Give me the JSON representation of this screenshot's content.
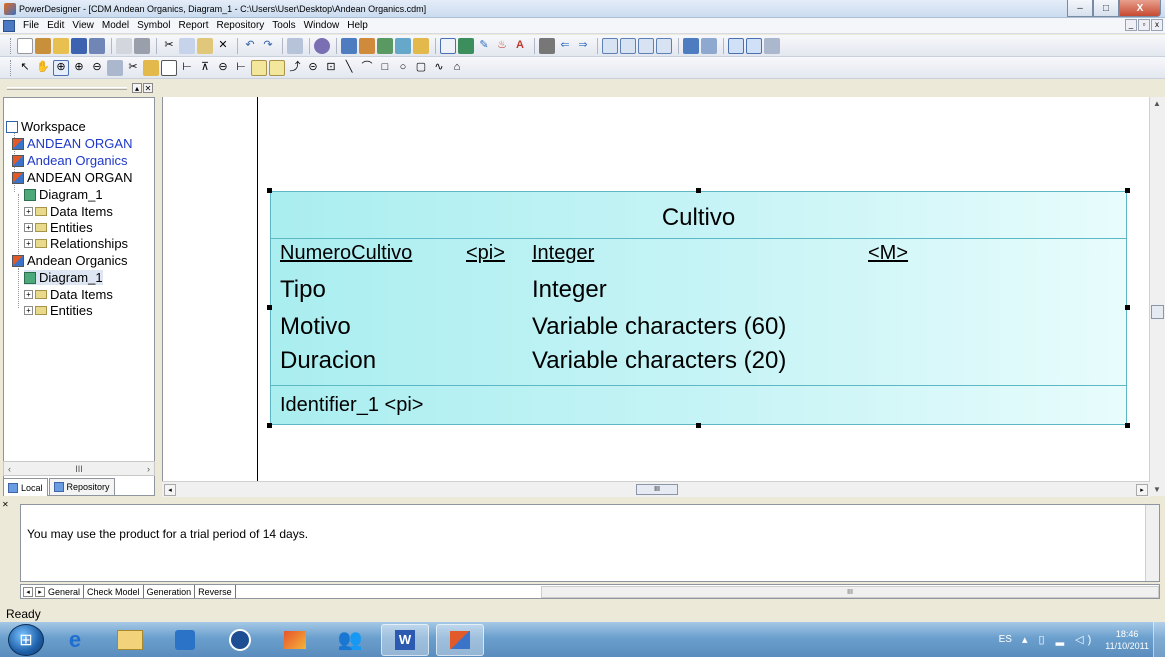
{
  "window": {
    "title": "PowerDesigner - [CDM Andean Organics, Diagram_1 - C:\\Users\\User\\Desktop\\Andean Organics.cdm]",
    "controls": {
      "minimize": "–",
      "maximize": "□",
      "close": "X"
    },
    "mdi_controls": {
      "minimize": "_",
      "restore": "▫",
      "close": "x"
    }
  },
  "menubar": {
    "items": [
      "File",
      "Edit",
      "View",
      "Model",
      "Symbol",
      "Report",
      "Repository",
      "Tools",
      "Window",
      "Help"
    ]
  },
  "browser": {
    "tree": [
      {
        "label": "Workspace",
        "kind": "workspace",
        "color": "black"
      },
      {
        "label": "ANDEAN ORGAN",
        "kind": "model",
        "color": "blue"
      },
      {
        "label": "Andean Organics",
        "kind": "model",
        "color": "blue"
      },
      {
        "label": "ANDEAN ORGAN",
        "kind": "model",
        "color": "black"
      },
      {
        "label": "Diagram_1",
        "kind": "diagram",
        "color": "black"
      },
      {
        "label": "Data Items",
        "kind": "folder",
        "color": "black"
      },
      {
        "label": "Entities",
        "kind": "folder",
        "color": "black"
      },
      {
        "label": "Relationships",
        "kind": "folder",
        "color": "black"
      },
      {
        "label": "Andean Organics",
        "kind": "model",
        "color": "black"
      },
      {
        "label": "Diagram_1",
        "kind": "diagram",
        "color": "black"
      },
      {
        "label": "Data Items",
        "kind": "folder",
        "color": "black"
      },
      {
        "label": "Entities",
        "kind": "folder",
        "color": "black"
      }
    ],
    "tabs": [
      "Local",
      "Repository"
    ],
    "scroll_thumb": "III"
  },
  "entity": {
    "name": "Cultivo",
    "attributes": [
      {
        "name": "NumeroCultivo",
        "pi": "<pi>",
        "type": "Integer",
        "mandatory": "<M>",
        "identifier": true
      },
      {
        "name": "Tipo",
        "pi": "",
        "type": "Integer",
        "mandatory": "",
        "identifier": false
      },
      {
        "name": "Motivo",
        "pi": "",
        "type": "Variable characters (60)",
        "mandatory": "",
        "identifier": false
      },
      {
        "name": "Duracion",
        "pi": "",
        "type": "Variable characters (20)",
        "mandatory": "",
        "identifier": false
      }
    ],
    "identifier": "Identifier_1  <pi>",
    "fill_color_start": "#aaeef0",
    "fill_color_end": "#e8fcfc",
    "border_color": "#5cb8c4"
  },
  "canvas_scroll_thumb": "III",
  "output": {
    "message": "You may use the product for a trial period of 14 days.",
    "tabs": [
      "General",
      "Check Model",
      "Generation",
      "Reverse"
    ],
    "scroll_thumb": "III"
  },
  "status": {
    "text": "Ready"
  },
  "taskbar": {
    "apps": [
      "internet-explorer-icon",
      "file-explorer-icon",
      "media-player-icon",
      "hp-icon",
      "photo-icon",
      "users-icon",
      "word-icon",
      "powerdesigner-icon"
    ],
    "language": "ES",
    "time": "18:46",
    "date": "11/10/2011"
  }
}
